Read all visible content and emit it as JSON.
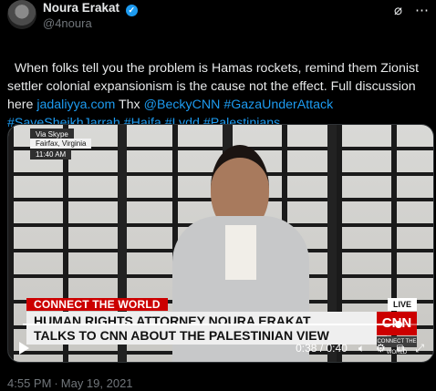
{
  "author": {
    "name": "Noura Erakat",
    "handle": "@4noura",
    "verified_icon": "verified-badge-icon"
  },
  "header_icons": [
    "grok-icon",
    "more-options-icon"
  ],
  "tweet": {
    "text_before_link": "When folks tell you the problem is Hamas rockets, remind them Zionist settler colonial expansionism is the cause not the effect. Full discussion here ",
    "link_text": "jadaliyya.com",
    "text_after_link": " Thx ",
    "mention": "@BeckyCNN",
    "hashtags": [
      "#GazaUnderAttack",
      "#SaveSheikhJarrah",
      "#Haifa",
      "#Lydd",
      "#Palestinians"
    ]
  },
  "video": {
    "skype_label": "Via Skype",
    "location": "Fairfax, Virginia",
    "time_label": "11:40 AM",
    "banner_title": "CONNECT THE WORLD",
    "lower_third_line1": "HUMAN RIGHTS ATTORNEY NOURA ERAKAT",
    "lower_third_line2": "TALKS TO CNN ABOUT THE PALESTINIAN VIEW",
    "live_label": "LIVE",
    "network_logo": "CNN",
    "network_sub": "CONNECT THE WORLD",
    "progress_fraction": 0.95,
    "time_display": "0:38 / 0:40",
    "icons": [
      "play-icon",
      "volume-icon",
      "settings-icon",
      "pip-icon",
      "fullscreen-icon"
    ]
  },
  "footer": {
    "time": "4:55 PM",
    "date": "May 19, 2021"
  }
}
